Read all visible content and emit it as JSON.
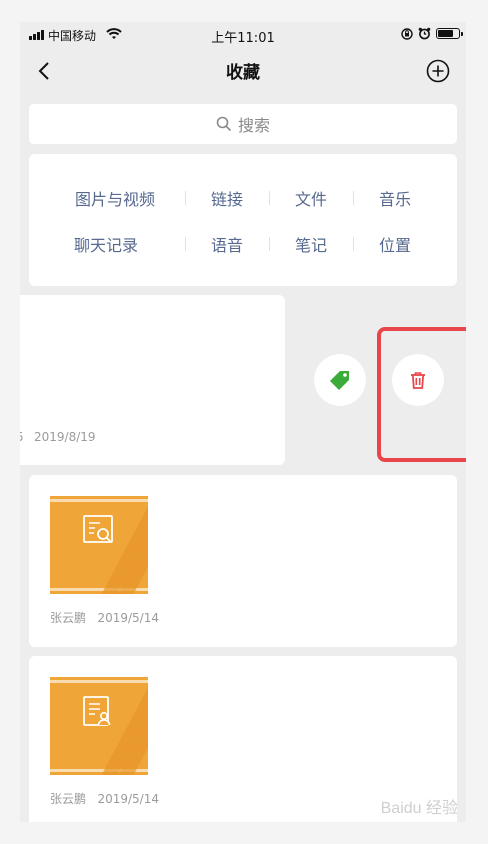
{
  "status_bar": {
    "carrier": "中国移动",
    "time": "上午11:01",
    "battery_level": 0.75
  },
  "nav": {
    "title": "收藏",
    "back_icon": "chevron-left-icon",
    "add_icon": "plus-circle-icon"
  },
  "search": {
    "placeholder": "搜索",
    "icon": "search-icon"
  },
  "categories": {
    "row1": [
      "图片与视频",
      "链接",
      "文件",
      "音乐"
    ],
    "row2": [
      "聊天记录",
      "语音",
      "笔记",
      "位置"
    ]
  },
  "items": [
    {
      "meta_partial": "5",
      "date": "2019/8/19"
    },
    {
      "author": "张云鹏",
      "date": "2019/5/14",
      "thumb_icon": "doc-search-icon"
    },
    {
      "author": "张云鹏",
      "date": "2019/5/14",
      "thumb_icon": "doc-user-icon"
    }
  ],
  "swipe_actions": {
    "tag_icon": "tag-icon",
    "delete_icon": "trash-icon",
    "tag_color": "#3bab3a",
    "delete_color": "#e8464a"
  },
  "watermark": "Baidu 经验",
  "colors": {
    "category_text": "#57698f",
    "thumb_bg": "#efa538",
    "highlight": "#e8464a"
  }
}
